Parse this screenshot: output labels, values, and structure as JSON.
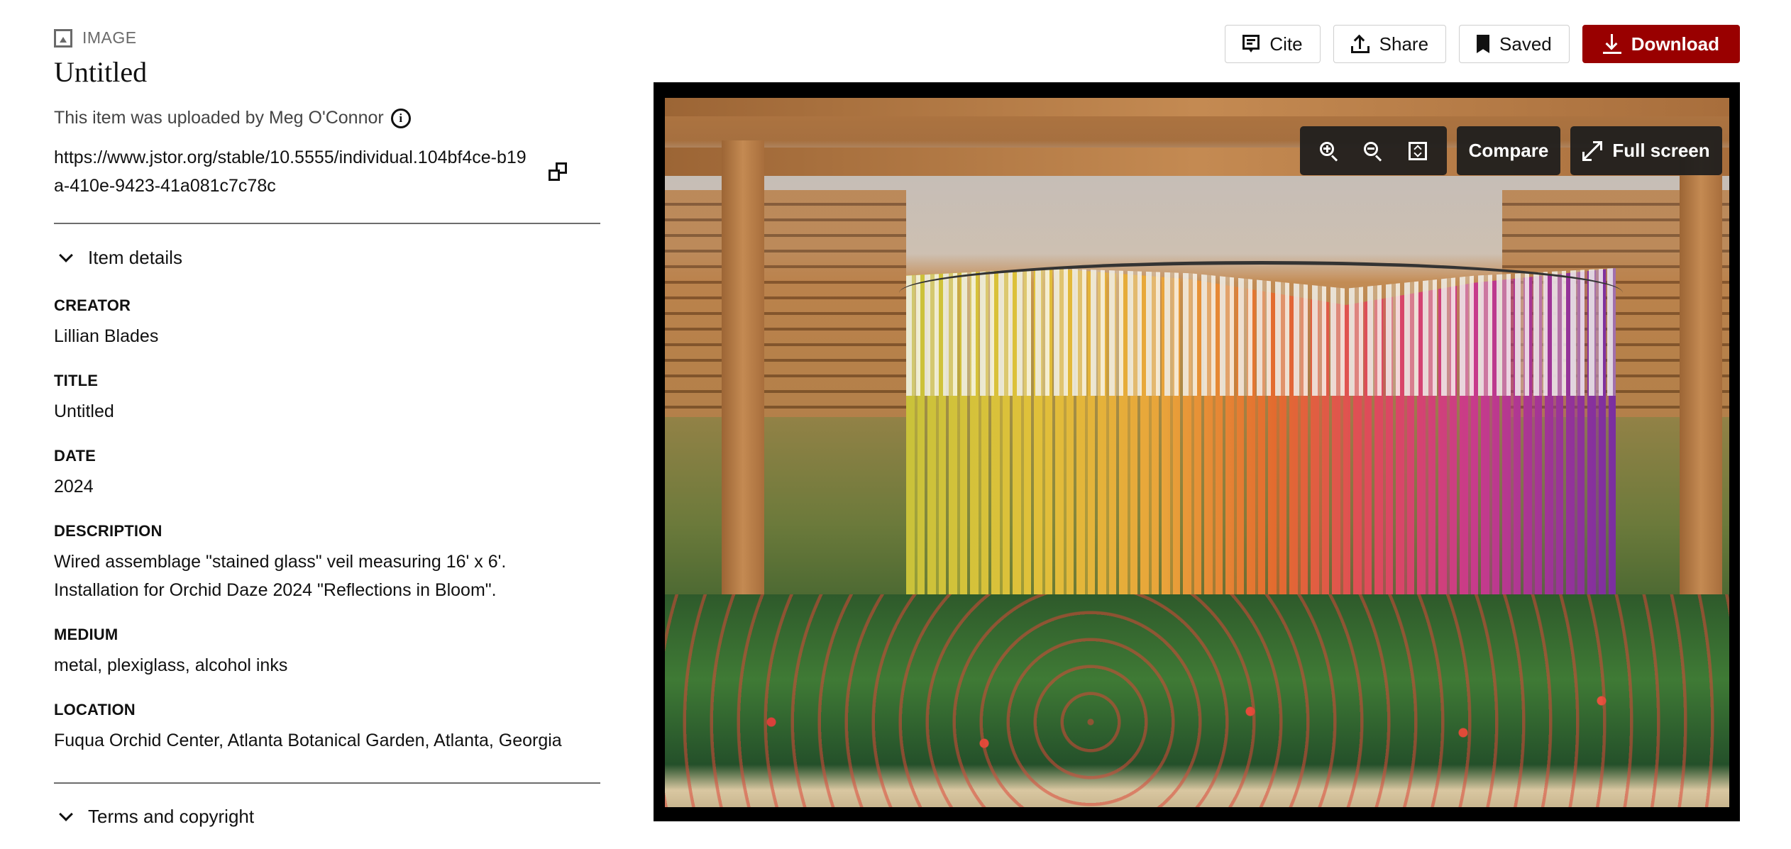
{
  "header": {
    "item_type": "IMAGE",
    "title": "Untitled",
    "uploader_text": "This item was uploaded by Meg O'Connor",
    "stable_url": "https://www.jstor.org/stable/10.5555/individual.104bf4ce-b19a-410e-9423-41a081c7c78c"
  },
  "actions": {
    "cite": "Cite",
    "share": "Share",
    "saved": "Saved",
    "download": "Download"
  },
  "viewer": {
    "zoom_in_icon": "zoom-in-icon",
    "zoom_out_icon": "zoom-out-icon",
    "fit_icon": "fit-to-screen-icon",
    "compare_label": "Compare",
    "fullscreen_label": "Full screen",
    "image_alt": "Colorful hanging stained-glass-style veil installation in a greenhouse pergola"
  },
  "sections": {
    "item_details": "Item details",
    "terms": "Terms and copyright"
  },
  "fields": [
    {
      "label": "CREATOR",
      "value": "Lillian Blades"
    },
    {
      "label": "TITLE",
      "value": "Untitled"
    },
    {
      "label": "DATE",
      "value": "2024"
    },
    {
      "label": "DESCRIPTION",
      "value": "Wired assemblage \"stained glass\" veil measuring 16' x 6'. Installation for Orchid Daze 2024 \"Reflections in Bloom\"."
    },
    {
      "label": "MEDIUM",
      "value": "metal, plexiglass, alcohol inks"
    },
    {
      "label": "LOCATION",
      "value": "Fuqua Orchid Center, Atlanta Botanical Garden, Atlanta, Georgia"
    }
  ],
  "colors": {
    "primary_button": "#990000",
    "divider": "#6d6d6d",
    "muted_text": "#6a6a6a",
    "viewer_frame": "#000000",
    "toolbar_bg": "#1c1c1c"
  }
}
